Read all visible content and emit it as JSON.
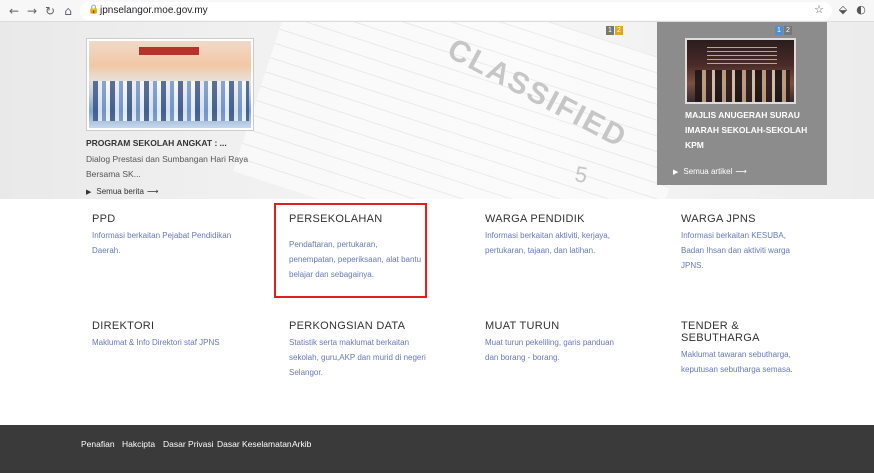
{
  "browser": {
    "url": "jpnselangor.moe.gov.my",
    "icons": [
      "back-icon",
      "forward-icon",
      "reload-icon",
      "home-icon",
      "lock-icon",
      "star-icon",
      "extension-icon",
      "profile-icon"
    ]
  },
  "hero": {
    "stamp_text": "CLASSIFIED",
    "stamp_number": "5",
    "news": {
      "title": "PROGRAM SEKOLAH ANGKAT : ...",
      "description": "Dialog Prestasi dan Sumbangan Hari Raya Bersama SK...",
      "more_label": "Semua berita",
      "pager": [
        "1",
        "2"
      ]
    },
    "article": {
      "title": "MAJLIS ANUGERAH SURAU IMARAH SEKOLAH-SEKOLAH KPM",
      "more_label": "Semua artikel",
      "pager": [
        "1",
        "2"
      ]
    }
  },
  "sections": [
    {
      "title": "PPD",
      "description": "Informasi berkaitan Pejabat Pendidikan Daerah."
    },
    {
      "title": "PERSEKOLAHAN",
      "description": "Pendaftaran, pertukaran, penempatan, peperiksaan, alat bantu belajar dan sebagainya."
    },
    {
      "title": "WARGA PENDIDIK",
      "description": "Informasi berkaitan aktiviti, kerjaya, pertukaran, tajaan, dan latihan."
    },
    {
      "title": "WARGA JPNS",
      "description": "Informasi berkaitan KESUBA, Badan Ihsan dan aktiviti warga JPNS."
    },
    {
      "title": "DIREKTORI",
      "description": "Maklumat & Info Direktori staf JPNS"
    },
    {
      "title": "PERKONGSIAN DATA",
      "description": "Statistik serta maklumat berkaitan sekolah, guru,AKP dan  murid di negeri Selangor."
    },
    {
      "title": "MUAT TURUN",
      "description": "Muat turun pekeliling, garis panduan dan borang - borang."
    },
    {
      "title": "TENDER & SEBUTHARGA",
      "description": "Maklumat tawaran sebutharga, keputusan sebutharga semasa."
    }
  ],
  "footer": {
    "links": [
      "Penafian",
      "Hakcipta",
      "Dasar Privasi",
      "Dasar Keselamatan",
      "Arkib"
    ]
  },
  "colors": {
    "highlight_border": "#e02020",
    "section_desc": "#6a78b8",
    "footer_bg": "#3a3a3a",
    "article_panel_bg": "#8c8c8c"
  }
}
